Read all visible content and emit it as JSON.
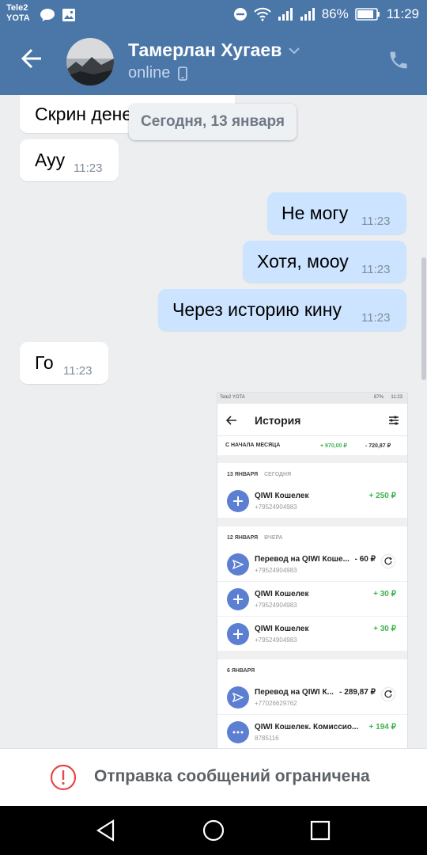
{
  "status_bar": {
    "carrier_line1": "Tele2",
    "carrier_line2": "YOTA",
    "battery": "86%",
    "time": "11:29"
  },
  "header": {
    "contact_name": "Тамерлан Хугаев",
    "status": "online"
  },
  "date_separator": "Сегодня, 13 января",
  "messages": [
    {
      "text": "Скрин дене",
      "time": ""
    },
    {
      "text": "Ауу",
      "time": "11:23"
    },
    {
      "text": "Не могу",
      "time": "11:23"
    },
    {
      "text": "Хотя, мооу",
      "time": "11:23"
    },
    {
      "text": "Через историю кину",
      "time": "11:23"
    },
    {
      "text": "Го",
      "time": "11:23"
    }
  ],
  "attachment": {
    "status": {
      "carrier": "Tele2 YOTA",
      "battery": "87%",
      "time": "11:23"
    },
    "title": "История",
    "month": {
      "label": "С НАЧАЛА МЕСЯЦА",
      "income": "+ 970,00 ₽",
      "expense": "- 720,87 ₽"
    },
    "sections": [
      {
        "date": "13 ЯНВАРЯ",
        "sub": "СЕГОДНЯ",
        "items": [
          {
            "title": "QIWI Кошелек",
            "number": "+79524904983",
            "amount": "+ 250 ₽",
            "type": "in"
          }
        ]
      },
      {
        "date": "12 ЯНВАРЯ",
        "sub": "ВЧЕРА",
        "items": [
          {
            "title": "Перевод на QIWI Коше...",
            "number": "+79524904983",
            "amount": "- 60 ₽",
            "type": "out"
          },
          {
            "title": "QIWI Кошелек",
            "number": "+79524904983",
            "amount": "+ 30 ₽",
            "type": "in"
          },
          {
            "title": "QIWI Кошелек",
            "number": "+79524904983",
            "amount": "+ 30 ₽",
            "type": "in"
          }
        ]
      },
      {
        "date": "6 ЯНВАРЯ",
        "sub": "",
        "items": [
          {
            "title": "Перевод на QIWI К...",
            "number": "+77026629762",
            "amount": "- 289,87 ₽",
            "type": "out"
          },
          {
            "title": "QIWI Кошелек. Комиссио...",
            "number": "8785116",
            "amount": "+ 194 ₽",
            "type": "other"
          }
        ]
      }
    ]
  },
  "footer": {
    "text": "Отправка сообщений ограничена"
  },
  "colors": {
    "header": "#4a76a8",
    "incoming_bubble": "#ffffff",
    "outgoing_bubble": "#cce4ff",
    "qiwi_icon": "#5c7fd1",
    "income_green": "#3fb34f",
    "warning_red": "#e64646"
  }
}
